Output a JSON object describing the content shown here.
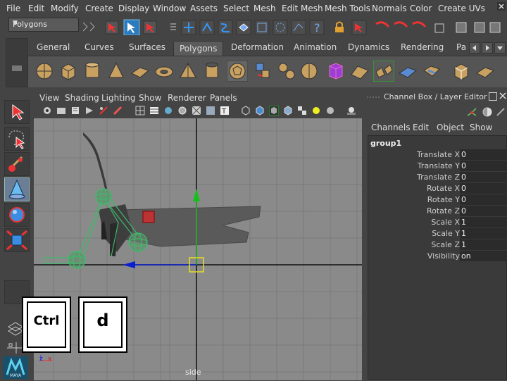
{
  "menubar": {
    "items": [
      "File",
      "Edit",
      "Modify",
      "Create",
      "Display",
      "Window",
      "Assets",
      "Select",
      "Mesh",
      "Edit Mesh",
      "Mesh Tools",
      "Normals",
      "Color",
      "Create UVs"
    ]
  },
  "statusline": {
    "mode_value": "Polygons"
  },
  "shelf": {
    "tabs": [
      "General",
      "Curves",
      "Surfaces",
      "Polygons",
      "Deformation",
      "Animation",
      "Dynamics",
      "Rendering",
      "Pa"
    ],
    "active_tab": "Polygons"
  },
  "panel": {
    "menu": [
      "View",
      "Shading",
      "Lighting",
      "Show",
      "Renderer",
      "Panels"
    ],
    "camera_label": "side",
    "axis_label_z": "z",
    "axis_label_x": "x"
  },
  "keys": {
    "ctrl": "Ctrl",
    "d": "d"
  },
  "channelbox": {
    "title": "Channel Box / Layer Editor",
    "menu": [
      "Channels",
      "Edit",
      "Object",
      "Show"
    ],
    "object_name": "group1",
    "attributes": [
      {
        "label": "Translate X",
        "value": "0"
      },
      {
        "label": "Translate Y",
        "value": "0"
      },
      {
        "label": "Translate Z",
        "value": "0"
      },
      {
        "label": "Rotate X",
        "value": "0"
      },
      {
        "label": "Rotate Y",
        "value": "0"
      },
      {
        "label": "Rotate Z",
        "value": "0"
      },
      {
        "label": "Scale X",
        "value": "1"
      },
      {
        "label": "Scale Y",
        "value": "1"
      },
      {
        "label": "Scale Z",
        "value": "1"
      },
      {
        "label": "Visibility",
        "value": "on"
      }
    ]
  },
  "colors": {
    "background": "#444444",
    "viewport": "#8a8a8a",
    "selection_green": "#3dbb6a",
    "manipulator_blue": "#0a1fd0",
    "manipulator_green": "#12c21a",
    "manipulator_yellow": "#e8e020"
  },
  "brand": {
    "logo_text": "MAYA"
  }
}
